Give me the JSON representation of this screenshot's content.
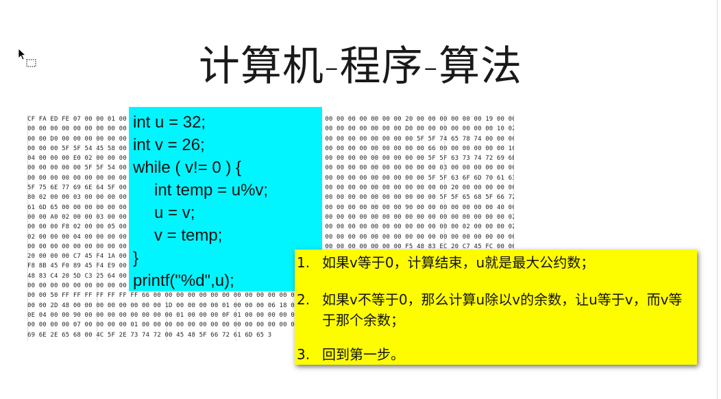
{
  "slide": {
    "title": "计算机-程序-算法"
  },
  "hex_dump": [
    "CF FA ED FE 07 00 00 01 00 00 00 00 00 00 00 00 00 00 00 00 00 00 00 00 00 00 00 00 00 00 00 00 00 20 00 00 00 00 00 00 19 00 00 00 88 01 00",
    "00 00 00 00 00 00 00 00 00 00 00 00 00 00 00 00 00 00 00 00 00 00 00 00 00 00 00 00 00 00 00 00 00 D0 00 00 00 00 00 00 00 10 02 00 00 00 00",
    "00 00 D0 00 00 00 00 00 00 00 00 00 00 00 00 00 00 00 00 00 00 00 00 00 00 00 00 00 00 00 00 00 00 00 5F 5F 74 65 78 74 00 00 00 00 00 00 00",
    "00 00 00 5F 5F 54 45 58 00 00 00 00 00 00 00 00 00 00 00 00 00 00 00 00 00 00 00 00 00 00 00 00 00 00 00 66 00 00 00 00 00 00 10 02 00 00",
    "04 00 00 00 E0 02 00 00 00 00 00 00 00 00 00 00 00 00 00 00 00 00 00 00 00 00 00 00 00 00 00 00 00 00 00 5F 5F 63 73 74 72 69 6E 67 00 00",
    "00 00 00 00 00 5F 5F 54 00 00 00 00 00 00 00 00 00 00 00 00 00 00 00 00 00 00 00 00 00 00 00 00 00 00 00 00 03 00 00 00 00 00 00 00 76 02",
    "00 00 00 00 00 00 00 00 00 00 00 00 00 00 00 00 00 00 00 00 00 00 00 00 00 00 00 00 00 00 00 00 00 00 00 5F 5F 63 6F 6D 70 61 63 74",
    "5F 75 6E 77 69 6E 64 5F 00 00 00 00 00 00 00 00 00 00 00 00 00 00 00 00 00 00 00 00 00 00 00 00 00 00 00 00 00 20 00 00 00 00 00 00 00",
    "80 02 00 00 03 00 00 00 00 00 00 00 00 00 00 00 00 00 00 00 00 00 00 00 00 00 00 00 00 00 00 00 00 00 00 00 5F 5F 65 68 5F 66 72",
    "61 6D 65 00 00 00 00 00 00 00 00 00 00 00 00 00 00 00 00 00 00 00 00 00 00 00 00 00 00 00 00 00 00 90 00 00 00 00 00 00 00 40 00 00 00 00",
    "00 00 A0 02 00 00 03 00 00 00 00 00 00 00 00 00 00 00 00 00 00 00 00 00 00 00 00 00 00 00 00 00 00 00 00 00 00 00 00 00 00 00 02 00 00 18",
    "00 00 00 F8 02 00 00 05 00 00 00 00 00 00 00 00 00 00 00 00 00 00 00 00 00 00 00 00 00 00 00 00 00 00 00 00 00 00 02 00 00 00 02 00 00 00",
    "02 00 00 00 04 00 00 00 00 00 00 00 00 00 00 00 00 00 00 00 00 00 00 00 00 00 00 00 00 00 00 00 00 00 00 00 00 00 00 00 00 00 00 00 00 00",
    "00 00 00 00 00 00 00 00 00 00 00 00 00 00 00 00 00 00 00 00 00 00 00 00 00 00 00 00 00 00 00 00 00 F5 48 83 EC 20 C7 45 FC 00 00 00 C7 45 F8",
    "20 00 00 00 C7 45 F4 1A 00 00 00 00 00 00 00 00 00 00 00 00 00 00 00 00 00 00 00 00 00 00 00 00 00 00 00 00 00 00 00 00 00 00 00 00 00 00",
    "F8 8B 45 F0 89 45 F4 E9 00 00 00 00 00 00 00 00 00 00 00 00 00 00 00 00 00 00 00 00 00 00 00 00 00 00 00 00 00 00 00 00 00 00 00 00 00 00",
    "48 83 C4 20 5D C3 25 64 00 00 00 00 00 00 00 00 00 00 00 00 00 00 00 00 00 00 00 00 00 00 00 00 00 00 00 00 00 00 00 00 00 00 00 00 00 00",
    "00 00 00 00 00 00 00 00 00 00 00 00 00 00 00 00 00 00 00 00 00 00 00 00 00 00 00 00 00 00 00 00 00 00 00 00 00 00 00 00 00 00 00 00 00 00",
    "00 00 50 FF FF FF FF FF FF FF 66 00 00 00 00 00 00 00 00 00 00 00 00 00 00 00 00 00 00 00 00 00 00 00 00 00 41 0E 10",
    "00 00 2D 48 00 00 00 00 00 00 00 00 1D 00 00 00 00 01 00 00 00 06 18 00 00 00",
    "0E 04 00 00 90 00 00 00 00 00 00 00 00 01 00 00 00 0F 01 00 00 00 00 00 00 00",
    "00 00 00 00 07 00 00 00 00 01 00 00 00 00 00 00 00 00 00 00 00 00 00 00 00 00",
    "69 6E 2E 65 68 00 4C 5F 2E 73 74 72 00 45 48 5F 66 72 61 6D 65 3"
  ],
  "code": {
    "lines": [
      "int u = 32;",
      "int v = 26;",
      "while ( v!= 0 ) {",
      "int temp = u%v;",
      "u = v;",
      "v = temp;",
      "}",
      "printf(\"%d\",u);"
    ]
  },
  "notes": [
    {
      "number": "1.",
      "text": "如果v等于0，计算结束，u就是最大公约数；"
    },
    {
      "number": "2.",
      "text": "如果v不等于0，那么计算u除以v的余数，让u等于v，而v等于那个余数；"
    },
    {
      "number": "3.",
      "text": "回到第一步。"
    }
  ],
  "colors": {
    "code_box": "#00f5ff",
    "note_box": "#fefd00"
  },
  "icons": {
    "cursor": "pointer-cursor-icon"
  }
}
